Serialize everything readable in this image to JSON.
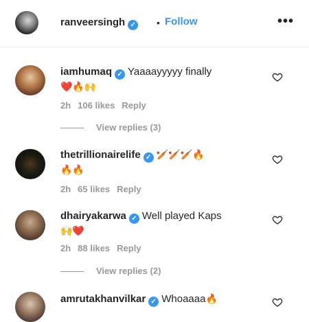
{
  "post_header": {
    "username": "ranveersingh",
    "verified": "✓",
    "separator": "•",
    "follow_label": "Follow",
    "more_label": "•••"
  },
  "comments": [
    {
      "username": "iamhumaq",
      "verified": "✓",
      "text": "Yaaaayyyyy finally",
      "emojis_line1": "",
      "emojis_line2": "❤️🔥🙌",
      "time": "2h",
      "likes": "106 likes",
      "reply_label": "Reply",
      "view_replies": "View replies (3)"
    },
    {
      "username": "thetrillionairelife",
      "verified": "✓",
      "text": "",
      "emojis_line1": "🏏🏏🏏🔥",
      "emojis_line2": "🔥🔥",
      "time": "2h",
      "likes": "65 likes",
      "reply_label": "Reply",
      "view_replies": ""
    },
    {
      "username": "dhairyakarwa",
      "verified": "✓",
      "text": "Well played Kaps",
      "emojis_line1": "",
      "emojis_line2": "🙌❤️",
      "time": "2h",
      "likes": "88 likes",
      "reply_label": "Reply",
      "view_replies": "View replies (2)"
    },
    {
      "username": "amrutakhanvilkar",
      "verified": "✓",
      "text": "Whoaaaa",
      "emojis_line1": "🔥",
      "emojis_line2": "",
      "time": "",
      "likes": "",
      "reply_label": "",
      "view_replies": ""
    }
  ]
}
